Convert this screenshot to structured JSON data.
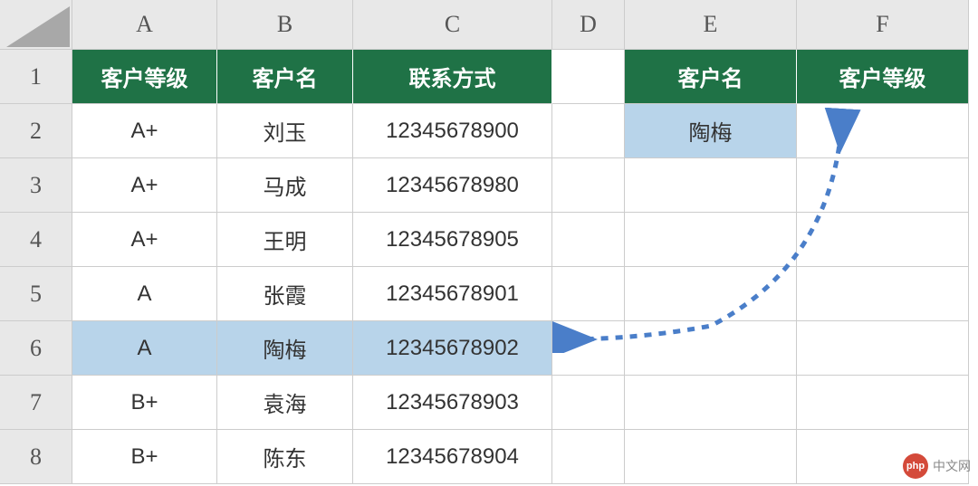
{
  "columns": [
    "A",
    "B",
    "C",
    "D",
    "E",
    "F"
  ],
  "rows": [
    "1",
    "2",
    "3",
    "4",
    "5",
    "6",
    "7",
    "8"
  ],
  "mainTable": {
    "headers": {
      "level": "客户等级",
      "name": "客户名",
      "contact": "联系方式"
    },
    "data": [
      {
        "level": "A+",
        "name": "刘玉",
        "contact": "12345678900"
      },
      {
        "level": "A+",
        "name": "马成",
        "contact": "12345678980"
      },
      {
        "level": "A+",
        "name": "王明",
        "contact": "12345678905"
      },
      {
        "level": "A",
        "name": "张霞",
        "contact": "12345678901"
      },
      {
        "level": "A",
        "name": "陶梅",
        "contact": "12345678902"
      },
      {
        "level": "B+",
        "name": "袁海",
        "contact": "12345678903"
      },
      {
        "level": "B+",
        "name": "陈东",
        "contact": "12345678904"
      }
    ]
  },
  "lookupTable": {
    "headers": {
      "name": "客户名",
      "level": "客户等级"
    },
    "data": {
      "name": "陶梅",
      "level": ""
    }
  },
  "highlightedRow": 4,
  "watermark": {
    "logo": "php",
    "text": "中文网"
  },
  "colors": {
    "headerBg": "#1f7246",
    "highlight": "#b8d4ea",
    "arrow": "#4a7ec9"
  }
}
